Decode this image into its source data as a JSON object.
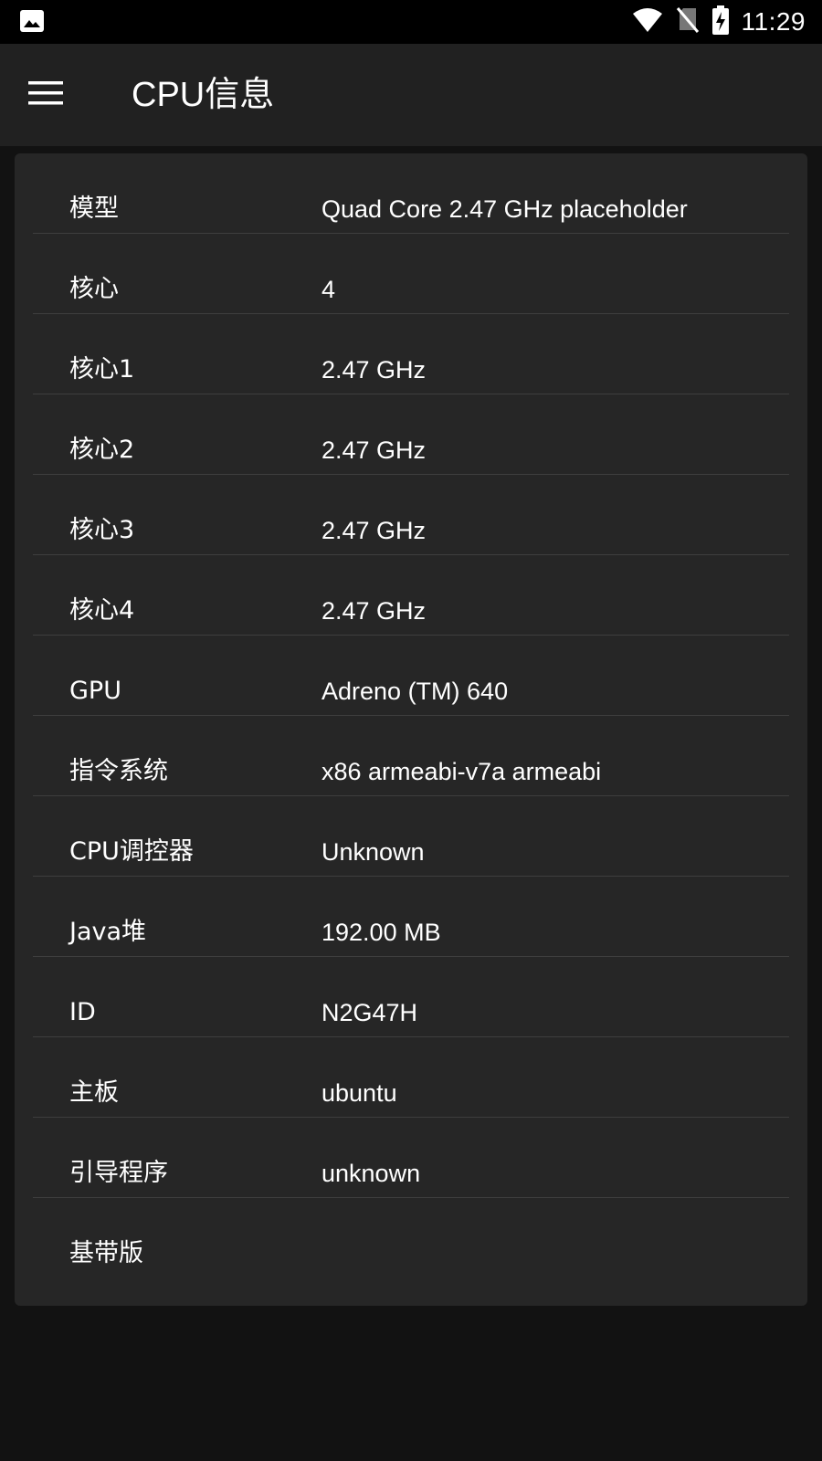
{
  "status_bar": {
    "time": "11:29",
    "icons": [
      "image-notification-icon",
      "wifi-icon",
      "no-sim-icon",
      "battery-charging-icon"
    ]
  },
  "app_bar": {
    "title": "CPU信息",
    "menu_icon": "hamburger-menu-icon"
  },
  "cpu_info": {
    "rows": [
      {
        "label": "模型",
        "value": "Quad Core 2.47 GHz placeholder"
      },
      {
        "label": "核心",
        "value": "4"
      },
      {
        "label": "核心1",
        "value": "2.47 GHz"
      },
      {
        "label": "核心2",
        "value": "2.47 GHz"
      },
      {
        "label": "核心3",
        "value": "2.47 GHz"
      },
      {
        "label": "核心4",
        "value": "2.47 GHz"
      },
      {
        "label": "GPU",
        "value": "Adreno (TM) 640"
      },
      {
        "label": "指令系统",
        "value": "x86 armeabi-v7a armeabi"
      },
      {
        "label": "CPU调控器",
        "value": "Unknown"
      },
      {
        "label": "Java堆",
        "value": "192.00 MB"
      },
      {
        "label": "ID",
        "value": "N2G47H"
      },
      {
        "label": "主板",
        "value": "ubuntu"
      },
      {
        "label": "引导程序",
        "value": "unknown"
      },
      {
        "label": "基带版",
        "value": ""
      }
    ]
  },
  "colors": {
    "status_bar_bg": "#000000",
    "app_bar_bg": "#212121",
    "card_bg": "#262626",
    "page_bg": "#121212",
    "divider": "#3e3e3e",
    "text": "#ffffff"
  }
}
